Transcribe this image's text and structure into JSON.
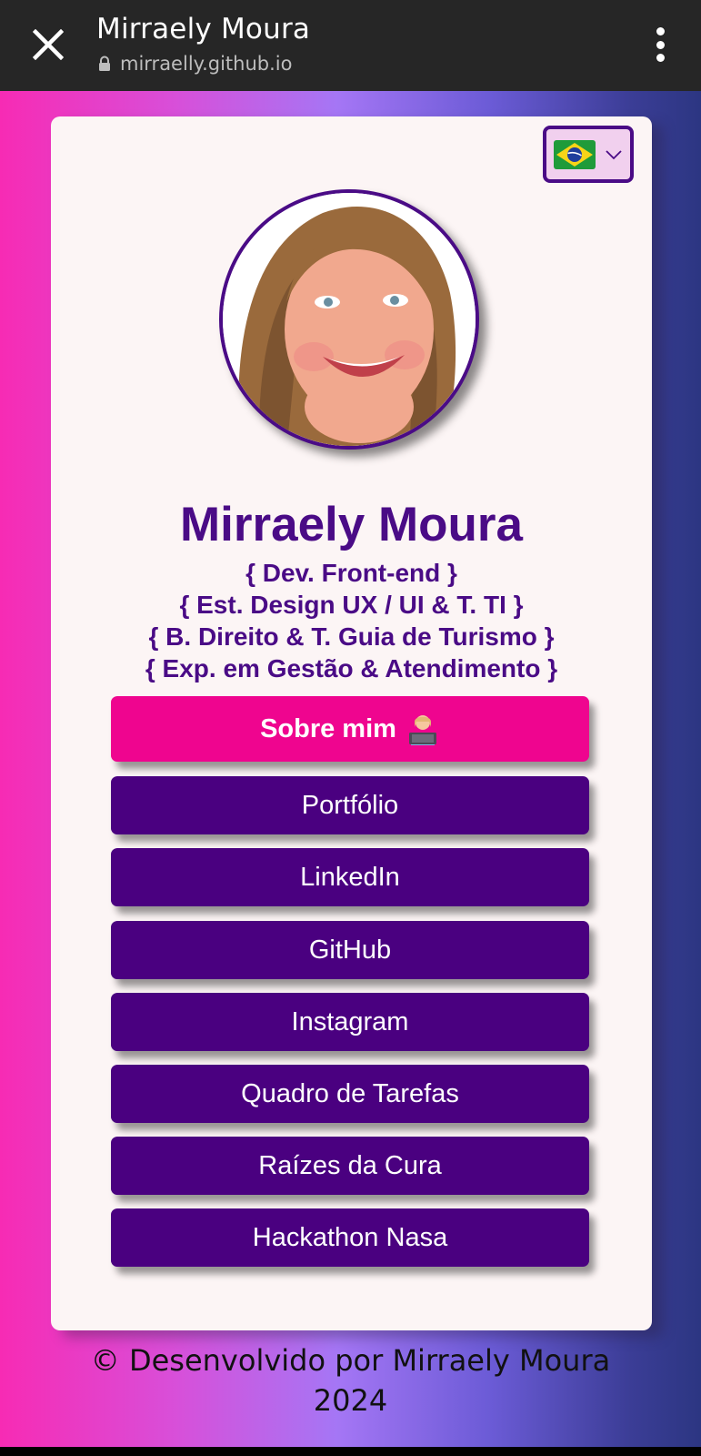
{
  "browser": {
    "title": "Mirraely Moura",
    "url": "mirraelly.github.io"
  },
  "profile": {
    "name": "Mirraely Moura",
    "taglines": [
      "{ Dev. Front-end }",
      "{ Est. Design UX / UI & T. TI }",
      "{ B. Direito & T. Guia de Turismo }",
      "{ Exp. em Gestão & Atendimento }"
    ]
  },
  "language": {
    "selected": "brazil-flag"
  },
  "buttons": {
    "about": "Sobre mim",
    "portfolio": "Portfólio",
    "linkedin": "LinkedIn",
    "github": "GitHub",
    "instagram": "Instagram",
    "tasks": "Quadro de Tarefas",
    "raizes": "Raízes da Cura",
    "hackathon": "Hackathon Nasa"
  },
  "footer": {
    "line1": "© Desenvolvido por Mirraely Moura",
    "line2": "2024"
  },
  "colors": {
    "purple": "#4a0080",
    "pink": "#ef058f",
    "card": "#fcf5f5"
  }
}
